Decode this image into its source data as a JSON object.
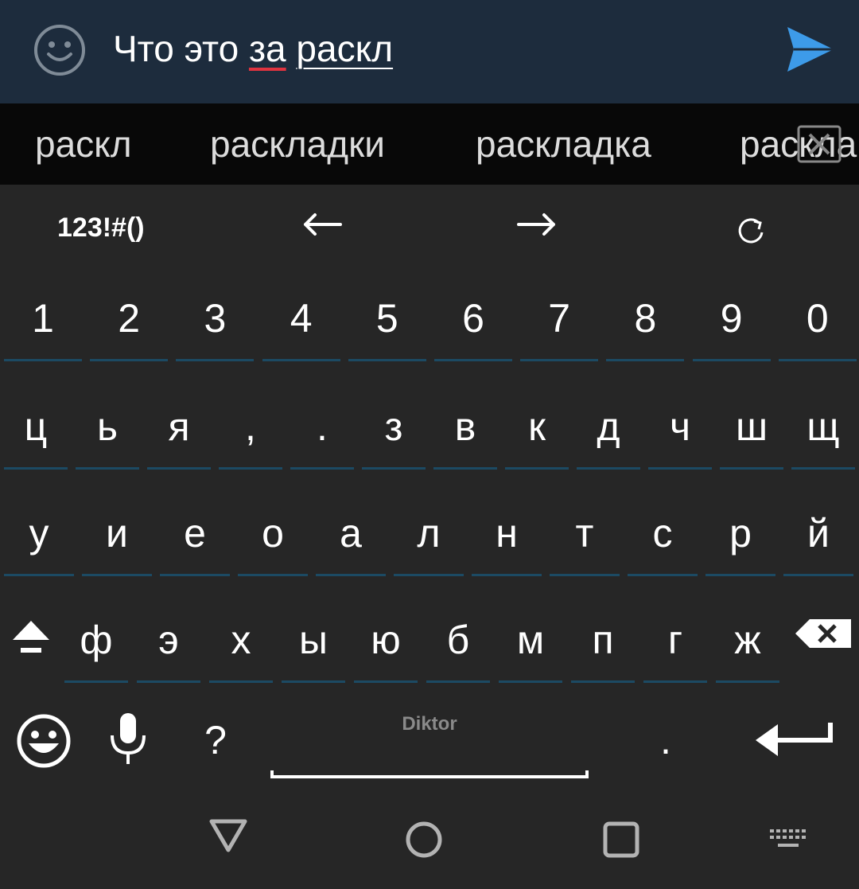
{
  "input": {
    "text_plain": "Что это ",
    "text_spell": "за",
    "text_space": " ",
    "text_compose": "раскл"
  },
  "suggestions": [
    "раскл",
    "раскладки",
    "раскладка",
    "раскла"
  ],
  "toolbar": {
    "numbers_label": "123!#()",
    "left_arrow": "←",
    "right_arrow": "→"
  },
  "rows": {
    "numbers": [
      "1",
      "2",
      "3",
      "4",
      "5",
      "6",
      "7",
      "8",
      "9",
      "0"
    ],
    "row1": [
      "ц",
      "ь",
      "я",
      ",",
      ".",
      "з",
      "в",
      "к",
      "д",
      "ч",
      "ш",
      "щ"
    ],
    "row2": [
      "у",
      "и",
      "е",
      "о",
      "а",
      "л",
      "н",
      "т",
      "с",
      "р",
      "й"
    ],
    "row3": [
      "ф",
      "э",
      "х",
      "ы",
      "ю",
      "б",
      "м",
      "п",
      "г",
      "ж"
    ]
  },
  "bottom_row": {
    "question": "?",
    "space_label": "Diktor",
    "period": "."
  },
  "icons": {
    "emoji": "emoji-icon",
    "send": "send-icon",
    "shift": "shift-icon",
    "backspace": "backspace-icon",
    "mic": "microphone-icon",
    "enter": "enter-icon",
    "refresh": "refresh-icon",
    "nav_back": "back-triangle-icon",
    "nav_home": "home-circle-icon",
    "nav_recents": "recents-square-icon",
    "nav_keyboard": "keyboard-icon"
  },
  "colors": {
    "input_bar": "#1d2c3d",
    "suggestion_bar": "#080808",
    "keyboard_bg": "#262626",
    "key_underline": "#1c4a63",
    "send_accent": "#3d9be9",
    "spell_error": "#e0333f"
  }
}
